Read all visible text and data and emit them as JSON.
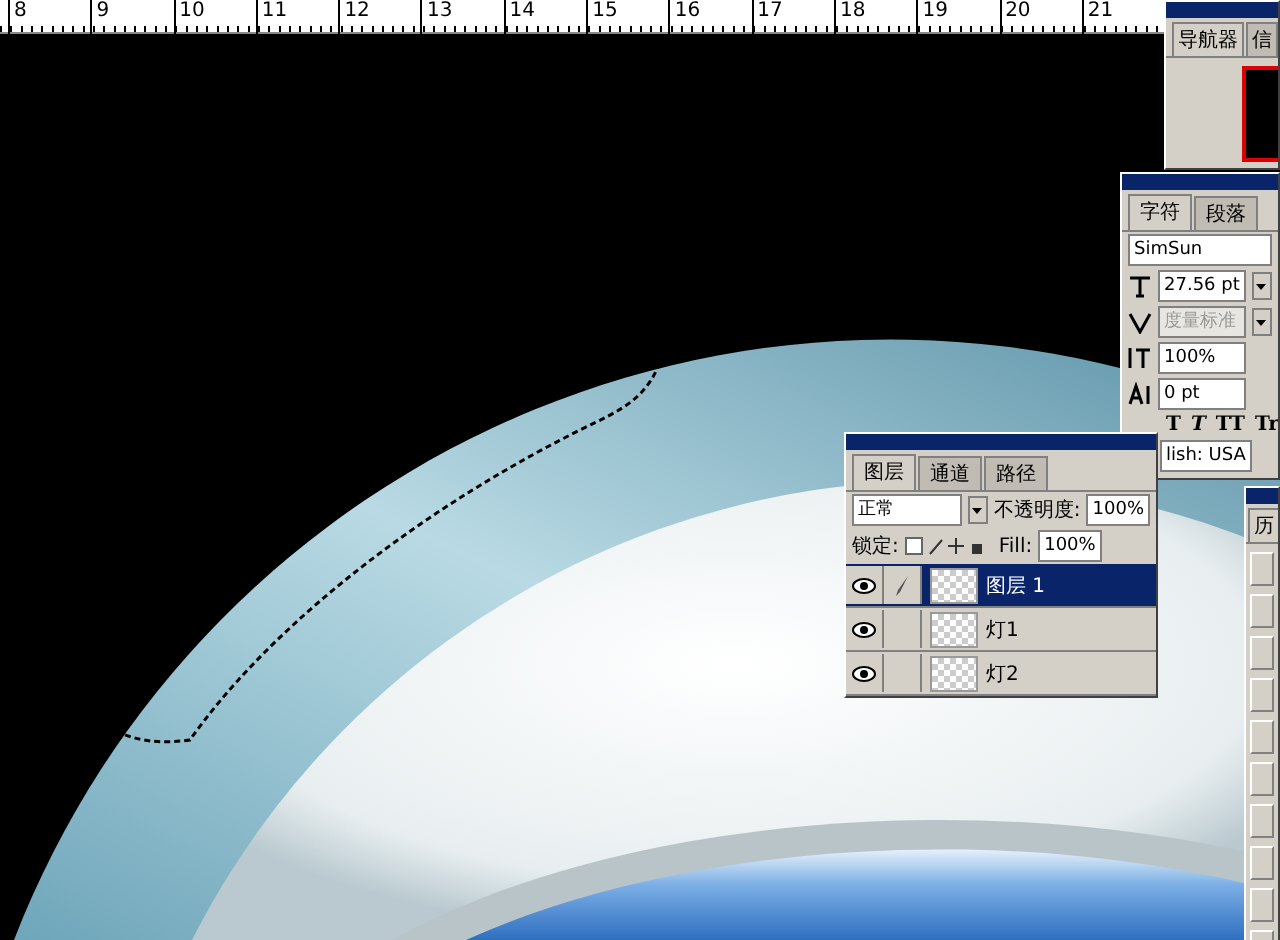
{
  "ruler": {
    "labels": [
      "8",
      "9",
      "10",
      "11",
      "12",
      "13",
      "14",
      "15",
      "16",
      "17",
      "18",
      "19",
      "20",
      "21"
    ]
  },
  "navigator_panel": {
    "tabs": [
      {
        "label": "导航器",
        "selected": true
      },
      {
        "label": "信",
        "selected": false
      }
    ]
  },
  "character_panel": {
    "tabs": [
      {
        "label": "字符",
        "selected": true
      },
      {
        "label": "段落",
        "selected": false
      }
    ],
    "font": "SimSun",
    "size": "27.56 pt",
    "kerning": {
      "value": "度量标准",
      "disabled": true
    },
    "scale": "100%",
    "baseline": "0 pt",
    "style_buttons": [
      "T",
      "T",
      "TT",
      "Tr"
    ],
    "language": "lish: USA"
  },
  "layers_panel": {
    "tabs": [
      {
        "label": "图层",
        "selected": true
      },
      {
        "label": "通道",
        "selected": false
      },
      {
        "label": "路径",
        "selected": false
      }
    ],
    "blend_mode": "正常",
    "opacity_label": "不透明度:",
    "opacity": "100%",
    "lock_label": "锁定:",
    "fill_label": "Fill:",
    "fill": "100%",
    "layers": [
      {
        "name": "图层 1",
        "visible": true,
        "selected": true
      },
      {
        "name": "灯1",
        "visible": true,
        "selected": false
      },
      {
        "name": "灯2",
        "visible": true,
        "selected": false
      }
    ]
  },
  "history_panel": {
    "tab": "历"
  }
}
